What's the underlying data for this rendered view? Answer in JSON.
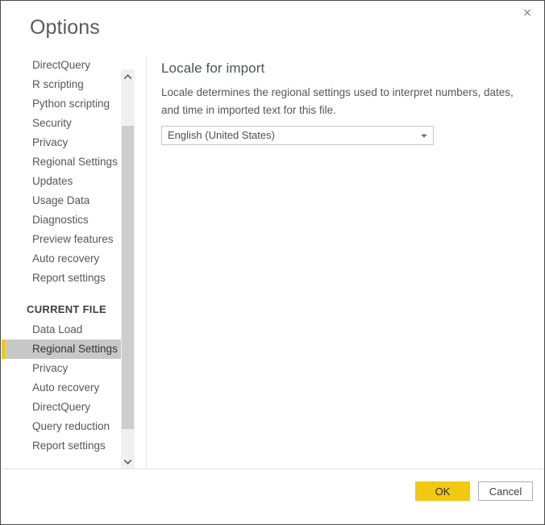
{
  "window": {
    "title": "Options",
    "close_icon": "close-icon",
    "close_label": "×"
  },
  "theme": {
    "accent": "#f2c811",
    "selection_background": "#c8c8c8",
    "dialog_border": "#4a4a4a",
    "text": "#55575a",
    "scroll_thumb": "#cdcdcd"
  },
  "sidebar": {
    "global_items": [
      {
        "label": "DirectQuery",
        "selected": false
      },
      {
        "label": "R scripting",
        "selected": false
      },
      {
        "label": "Python scripting",
        "selected": false
      },
      {
        "label": "Security",
        "selected": false
      },
      {
        "label": "Privacy",
        "selected": false
      },
      {
        "label": "Regional Settings",
        "selected": false
      },
      {
        "label": "Updates",
        "selected": false
      },
      {
        "label": "Usage Data",
        "selected": false
      },
      {
        "label": "Diagnostics",
        "selected": false
      },
      {
        "label": "Preview features",
        "selected": false
      },
      {
        "label": "Auto recovery",
        "selected": false
      },
      {
        "label": "Report settings",
        "selected": false
      }
    ],
    "section_header": "CURRENT FILE",
    "current_file_items": [
      {
        "label": "Data Load",
        "selected": false
      },
      {
        "label": "Regional Settings",
        "selected": true
      },
      {
        "label": "Privacy",
        "selected": false
      },
      {
        "label": "Auto recovery",
        "selected": false
      },
      {
        "label": "DirectQuery",
        "selected": false
      },
      {
        "label": "Query reduction",
        "selected": false
      },
      {
        "label": "Report settings",
        "selected": false
      }
    ],
    "scrollbar": {
      "up_icon": "chevron-up-icon",
      "down_icon": "chevron-down-icon"
    }
  },
  "content": {
    "title": "Locale for import",
    "description": "Locale determines the regional settings used to interpret numbers, dates, and time in imported text for this file.",
    "locale_dropdown": {
      "value": "English (United States)",
      "caret_icon": "chevron-down-icon"
    }
  },
  "footer": {
    "ok_label": "OK",
    "cancel_label": "Cancel"
  }
}
